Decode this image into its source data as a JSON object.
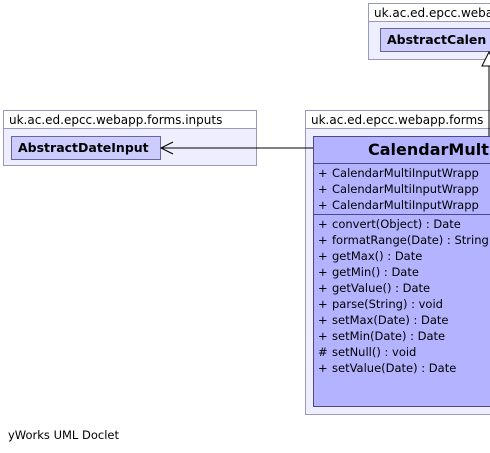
{
  "packages": {
    "top_right": {
      "label": "uk.ac.ed.epcc.webapp.",
      "class_name": "AbstractCalen"
    },
    "inputs": {
      "label": "uk.ac.ed.epcc.webapp.forms.inputs",
      "class_name": "AbstractDateInput"
    },
    "main": {
      "label": "uk.ac.ed.epcc.webapp.forms"
    }
  },
  "main_class": {
    "name": "CalendarMultiI",
    "constructors": [
      {
        "vis": "+",
        "text": "CalendarMultiInputWrapp"
      },
      {
        "vis": "+",
        "text": "CalendarMultiInputWrapp"
      },
      {
        "vis": "+",
        "text": "CalendarMultiInputWrapp"
      }
    ],
    "methods": [
      {
        "vis": "+",
        "text": "convert(Object) : Date"
      },
      {
        "vis": "+",
        "text": "formatRange(Date) : String"
      },
      {
        "vis": "+",
        "text": "getMax() : Date"
      },
      {
        "vis": "+",
        "text": "getMin() : Date"
      },
      {
        "vis": "+",
        "text": "getValue() : Date"
      },
      {
        "vis": "+",
        "text": "parse(String) : void"
      },
      {
        "vis": "+",
        "text": "setMax(Date) : Date"
      },
      {
        "vis": "+",
        "text": "setMin(Date) : Date"
      },
      {
        "vis": "#",
        "text": "setNull() : void"
      },
      {
        "vis": "+",
        "text": "setValue(Date) : Date"
      }
    ]
  },
  "footer": "yWorks UML Doclet",
  "colors": {
    "package_fill": "#eeeeff",
    "class_fill": "#ccccff",
    "main_class_fill": "#b3b3ff"
  }
}
